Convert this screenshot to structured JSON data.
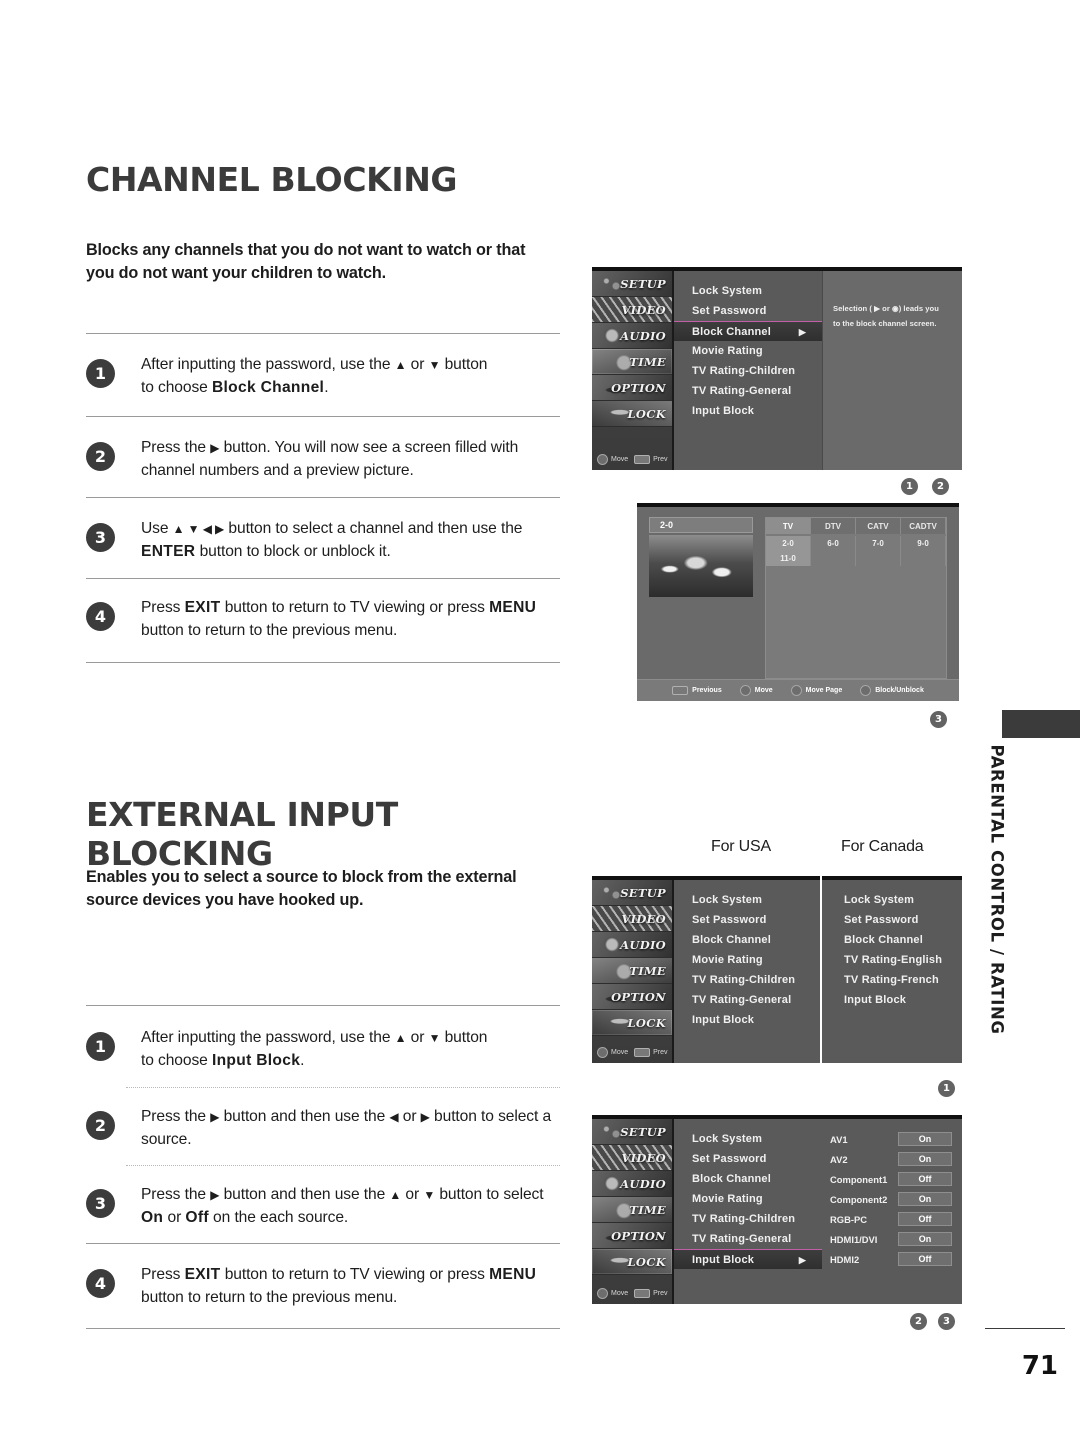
{
  "page": {
    "number": "71",
    "side_label": "PARENTAL CONTROL / RATING"
  },
  "section1": {
    "title": "CHANNEL BLOCKING",
    "intro": "Blocks any channels that you do not want to watch or that you do not want your children to watch.",
    "steps": [
      {
        "num": "1",
        "line1_a": "After inputting the password, use the ",
        "up": "▲",
        "or": " or ",
        "down": "▼",
        "line1_b": " button",
        "line2_a": "to choose ",
        "bold": "Block Channel",
        "line2_b": "."
      },
      {
        "num": "2",
        "text_a": "Press the ",
        "glyph": "▶",
        "text_b": " button. You will now see a screen filled with channel numbers and a preview picture."
      },
      {
        "num": "3",
        "text_a": "Use ",
        "glyphs": "▲ ▼ ◀ ▶",
        "text_b": " button to select a channel and then use the ",
        "bold": "ENTER",
        "text_c": " button to block or unblock it."
      },
      {
        "num": "4",
        "text_a": "Press ",
        "bold1": "EXIT",
        "text_b": " button to return to TV viewing or press ",
        "bold2": "MENU",
        "text_c": " button to return to the previous menu."
      }
    ]
  },
  "section2": {
    "title": "EXTERNAL INPUT BLOCKING",
    "intro": "Enables you to select a source to block from the external source devices you have hooked up.",
    "steps": [
      {
        "num": "1",
        "line1_a": "After inputting the password, use the ",
        "up": "▲",
        "or": " or ",
        "down": "▼",
        "line1_b": " button",
        "line2_a": "to choose ",
        "bold": "Input Block",
        "line2_b": "."
      },
      {
        "num": "2",
        "text_a": "Press the ",
        "g1": "▶",
        "text_b": " button and then use the ",
        "g2": "◀",
        "text_c": " or ",
        "g3": "▶",
        "text_d": " button to select a source."
      },
      {
        "num": "3",
        "text_a": "Press the ",
        "g1": "▶",
        "text_b": " button and then use the ",
        "g2": "▲",
        "text_c": " or ",
        "g3": "▼",
        "text_d": " button to select ",
        "bold1": "On",
        "text_e": " or ",
        "bold2": "Off",
        "text_f": " on the each source."
      },
      {
        "num": "4",
        "text_a": "Press ",
        "bold1": "EXIT",
        "text_b": " button to return to TV viewing or press ",
        "bold2": "MENU",
        "text_c": " button to return to the previous menu."
      }
    ]
  },
  "osd_common": {
    "side_tabs": [
      "SETUP",
      "VIDEO",
      "AUDIO",
      "TIME",
      "OPTION",
      "LOCK"
    ],
    "foot_move": "Move",
    "foot_prev": "Prev"
  },
  "osd_block_channel": {
    "items": [
      "Lock System",
      "Set Password",
      "Block Channel",
      "Movie Rating",
      "TV Rating-Children",
      "TV Rating-General",
      "Input Block"
    ],
    "selected": "Block Channel",
    "arrow": "▶",
    "hint_line1": "Selection ( ▶ or ◉) leads you",
    "hint_line2": "to the block channel screen."
  },
  "channel_grid": {
    "current_channel": "2-0",
    "tabs": [
      "TV",
      "DTV",
      "CATV",
      "CADTV"
    ],
    "active_tab": "TV",
    "rows": [
      [
        "2-0",
        "6-0",
        "7-0",
        "9-0"
      ],
      [
        "11-0",
        "",
        "",
        ""
      ]
    ],
    "blocked": [
      "2-0",
      "11-0"
    ],
    "footer": [
      "Previous",
      "Move",
      "Move Page",
      "Block/Unblock"
    ]
  },
  "caption_usa": "For USA",
  "caption_canada": "For Canada",
  "osd_usa": {
    "items": [
      "Lock System",
      "Set Password",
      "Block Channel",
      "Movie Rating",
      "TV Rating-Children",
      "TV Rating-General",
      "Input Block"
    ]
  },
  "osd_canada": {
    "items": [
      "Lock System",
      "Set Password",
      "Block Channel",
      "TV Rating-English",
      "TV Rating-French",
      "Input Block"
    ]
  },
  "osd_input_block": {
    "items": [
      "Lock System",
      "Set Password",
      "Block Channel",
      "Movie Rating",
      "TV Rating-Children",
      "TV Rating-General",
      "Input Block"
    ],
    "selected": "Input Block",
    "arrow": "▶",
    "sources": [
      {
        "label": "AV1",
        "value": "On"
      },
      {
        "label": "AV2",
        "value": "On"
      },
      {
        "label": "Component1",
        "value": "Off"
      },
      {
        "label": "Component2",
        "value": "On"
      },
      {
        "label": "RGB-PC",
        "value": "Off"
      },
      {
        "label": "HDMI1/DVI",
        "value": "On"
      },
      {
        "label": "HDMI2",
        "value": "Off"
      }
    ]
  },
  "markers": {
    "m1": "1",
    "m2": "2",
    "m3": "3"
  }
}
